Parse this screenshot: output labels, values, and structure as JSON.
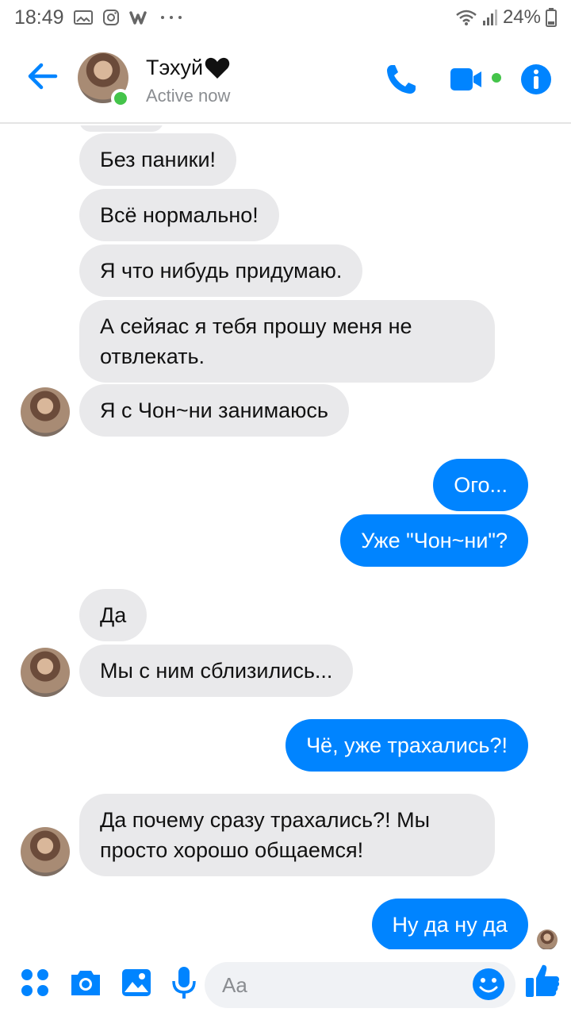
{
  "status_bar": {
    "time": "18:49",
    "battery": "24%",
    "icons": [
      "gallery-icon",
      "instagram-icon",
      "wattpad-icon",
      "more-dots-icon",
      "wifi-icon",
      "signal-icon",
      "battery-icon"
    ]
  },
  "header": {
    "contact_name": "Тэхуй",
    "contact_status": "Active now",
    "icons": [
      "back-arrow-icon",
      "phone-icon",
      "video-camera-icon",
      "info-icon"
    ],
    "name_suffix_icon": "black-heart-icon"
  },
  "messages": [
    {
      "side": "in",
      "text": "Без паники!"
    },
    {
      "side": "in",
      "text": "Всё нормально!"
    },
    {
      "side": "in",
      "text": "Я что нибудь придумаю."
    },
    {
      "side": "in",
      "text": "А сейяас я тебя прошу меня не отвлекать."
    },
    {
      "side": "in",
      "text": "Я с Чон~ни занимаюсь"
    },
    {
      "side": "out",
      "text": "Ого..."
    },
    {
      "side": "out",
      "text": "Уже \"Чон~ни\"?"
    },
    {
      "side": "in",
      "text": "Да"
    },
    {
      "side": "in",
      "text": "Мы с ним сблизились..."
    },
    {
      "side": "out",
      "text": "Чё, уже трахались?!"
    },
    {
      "side": "in",
      "text": "Да почему сразу трахались?! Мы просто хорошо общаемся!"
    },
    {
      "side": "out",
      "text": "Ну да ну да"
    }
  ],
  "composer": {
    "placeholder": "Aa",
    "icons": [
      "apps-menu-icon",
      "camera-icon",
      "image-icon",
      "microphone-icon",
      "emoji-icon",
      "thumbs-up-icon"
    ]
  },
  "colors": {
    "accent": "#0084ff",
    "incoming_bubble": "#e9e9eb",
    "online": "#44c44a"
  }
}
